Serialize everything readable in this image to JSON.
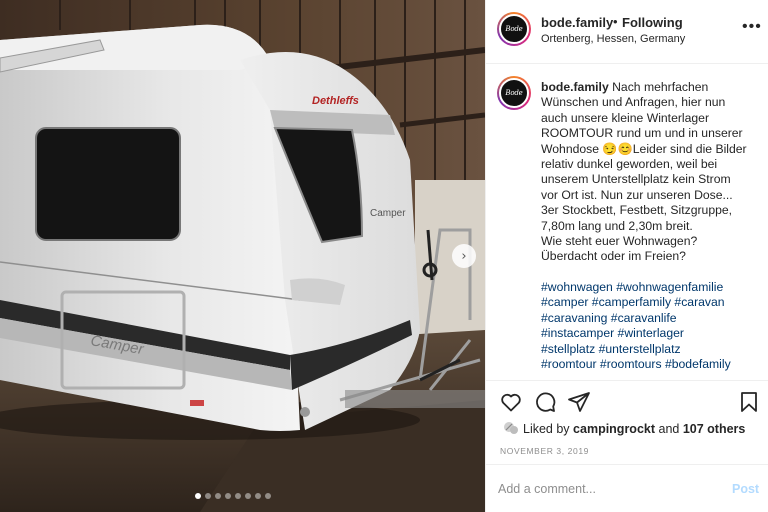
{
  "header": {
    "username": "bode.family",
    "separator": "•",
    "follow_status": "Following",
    "location": "Ortenberg, Hessen, Germany",
    "more_icon": "more-dots-icon",
    "avatar_text": "Bode FAMILY"
  },
  "caption": {
    "username": "bode.family",
    "lines": [
      "Nach mehrfachen",
      "Wünschen und Anfragen, hier nun",
      "auch unsere kleine Winterlager",
      "ROOMTOUR rund um und in unserer",
      "Wohndose 😏😊Leider sind die Bilder",
      "relativ dunkel geworden, weil bei",
      "unserem Unterstellplatz kein Strom",
      "vor Ort ist. Nun zur unseren Dose...",
      "3er Stockbett, Festbett, Sitzgruppe,",
      "7,80m lang und 2,30m breit.",
      "Wie steht euer Wohnwagen?",
      "Überdacht oder im Freien?"
    ],
    "hashtag_lines": [
      "#wohnwagen #wohnwagenfamilie",
      "#camper #camperfamily #caravan",
      "#caravaning #caravanlife",
      "#instacamper #winterlager",
      "#stellplatz #unterstellplatz",
      "#roomtour #roomtours #bodefamily"
    ]
  },
  "photo": {
    "brand_text": "Dethleffs",
    "model_text": "Camper",
    "side_text": "Camper",
    "carousel_count": 8,
    "carousel_active": 1
  },
  "actions": {
    "like_icon": "heart-icon",
    "comment_icon": "comment-icon",
    "share_icon": "share-icon",
    "save_icon": "bookmark-icon"
  },
  "likes": {
    "prefix": "Liked by",
    "liker": "campingrockt",
    "middle": "and",
    "others": "107 others"
  },
  "date": "NOVEMBER 3, 2019",
  "comment": {
    "placeholder": "Add a comment...",
    "post_label": "Post"
  },
  "colors": {
    "link_blue": "#00376b",
    "post_disabled": "#b3dbff",
    "meta_gray": "#8e8e8e"
  }
}
